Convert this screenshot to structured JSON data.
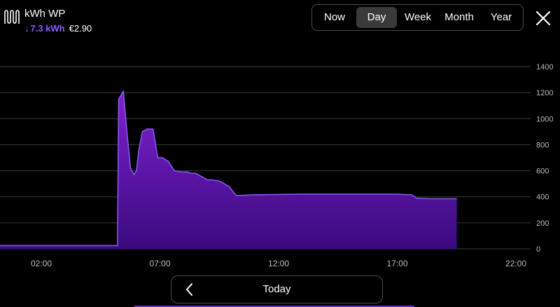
{
  "header": {
    "title": "kWh WP",
    "energy": "7.3 kWh",
    "cost": "€2.90"
  },
  "periods": [
    "Now",
    "Day",
    "Week",
    "Month",
    "Year"
  ],
  "active_period": "Day",
  "footer": {
    "label": "Today"
  },
  "colors": {
    "accent": "#8b5cf6",
    "fill_top": "#7e22ce",
    "fill_bottom": "#3b0a80"
  },
  "chart_data": {
    "type": "area",
    "ylim": [
      0,
      1400
    ],
    "y_ticks": [
      "0",
      "200",
      "400",
      "600",
      "800",
      "1000",
      "1200",
      "1400"
    ],
    "x_ticks": [
      "02:00",
      "07:00",
      "12:00",
      "17:00",
      "22:00"
    ],
    "x_tick_hours": [
      2,
      7,
      12,
      17,
      22
    ],
    "x_range_hours": [
      0.5,
      24.0
    ],
    "grid": true,
    "series": [
      {
        "x": [
          0.5,
          6.3,
          6.35,
          6.55,
          6.7,
          6.85,
          7.0,
          7.1,
          7.2,
          7.35,
          7.55,
          7.8,
          8.0,
          8.2,
          8.45,
          8.7,
          9.0,
          9.25,
          9.4,
          9.6,
          10.1,
          10.3,
          10.6,
          11.0,
          11.3,
          11.5,
          12.0,
          14.0,
          16.0,
          18.0,
          18.7,
          18.9,
          19.5,
          20.3,
          20.6
        ],
        "y": [
          25,
          25,
          1150,
          1210,
          900,
          620,
          570,
          600,
          760,
          900,
          920,
          920,
          700,
          700,
          670,
          600,
          590,
          590,
          580,
          580,
          530,
          530,
          520,
          480,
          410,
          410,
          415,
          420,
          420,
          420,
          415,
          390,
          385,
          385,
          385
        ]
      }
    ]
  }
}
